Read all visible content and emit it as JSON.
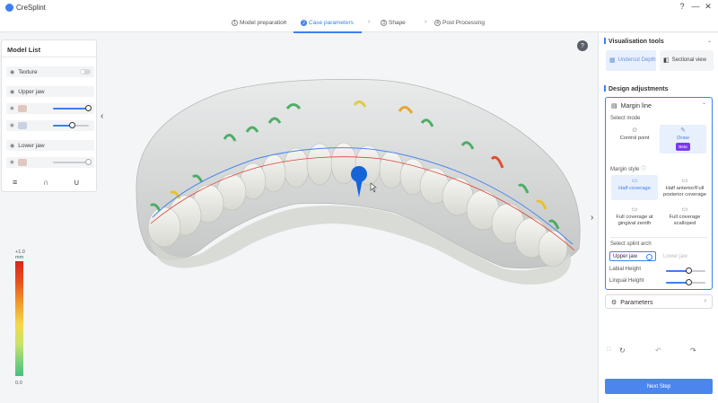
{
  "app": {
    "title": "CreSplint",
    "help": "?",
    "minimize": "—",
    "close": "✕"
  },
  "steps": [
    {
      "num": "1",
      "label": "Model preparation"
    },
    {
      "num": "2",
      "label": "Case parameters"
    },
    {
      "num": "3",
      "label": "Shape"
    },
    {
      "num": "4",
      "label": "Post Processing"
    }
  ],
  "model_list": {
    "title": "Model List",
    "texture_label": "Texture",
    "upper_label": "Upper jaw",
    "lower_label": "Lower jaw",
    "sliders": [
      {
        "name": "upper-opacity",
        "value": 1.0
      },
      {
        "name": "upper-offset",
        "value": 0.55
      },
      {
        "name": "lower-opacity",
        "value": 1.0
      }
    ]
  },
  "legend": {
    "max": "+1.0",
    "min": "0.0",
    "unit": "mm"
  },
  "help_glyph": "?",
  "visualisation": {
    "title": "Visualisation tools",
    "undercut_label": "Undercut Depth",
    "sectional_label": "Sectional view"
  },
  "design": {
    "title": "Design adjustments",
    "margin": {
      "title": "Margin line",
      "select_mode": "Select mode",
      "control_point": "Control point",
      "draw": "Draw",
      "beta": "Beta",
      "style_label": "Margin style",
      "half_coverage": "Half coverage",
      "half_anterior": "Half anterior/Full posterior coverage",
      "full_gingival": "Full coverage at gingival zenith",
      "full_scalloped": "Full coverage scalloped",
      "arch_label": "Select splint arch",
      "upper_jaw": "Upper jaw",
      "lower_jaw": "Lower jaw",
      "labial": "Labial Height",
      "lingual": "Lingual Height",
      "labial_value": 0.6,
      "lingual_value": 0.6
    },
    "parameters": "Parameters"
  },
  "next_step": "Next Step",
  "colors": {
    "accent": "#3d7ff2",
    "beta": "#7c3aed",
    "button": "#4a86ee"
  }
}
